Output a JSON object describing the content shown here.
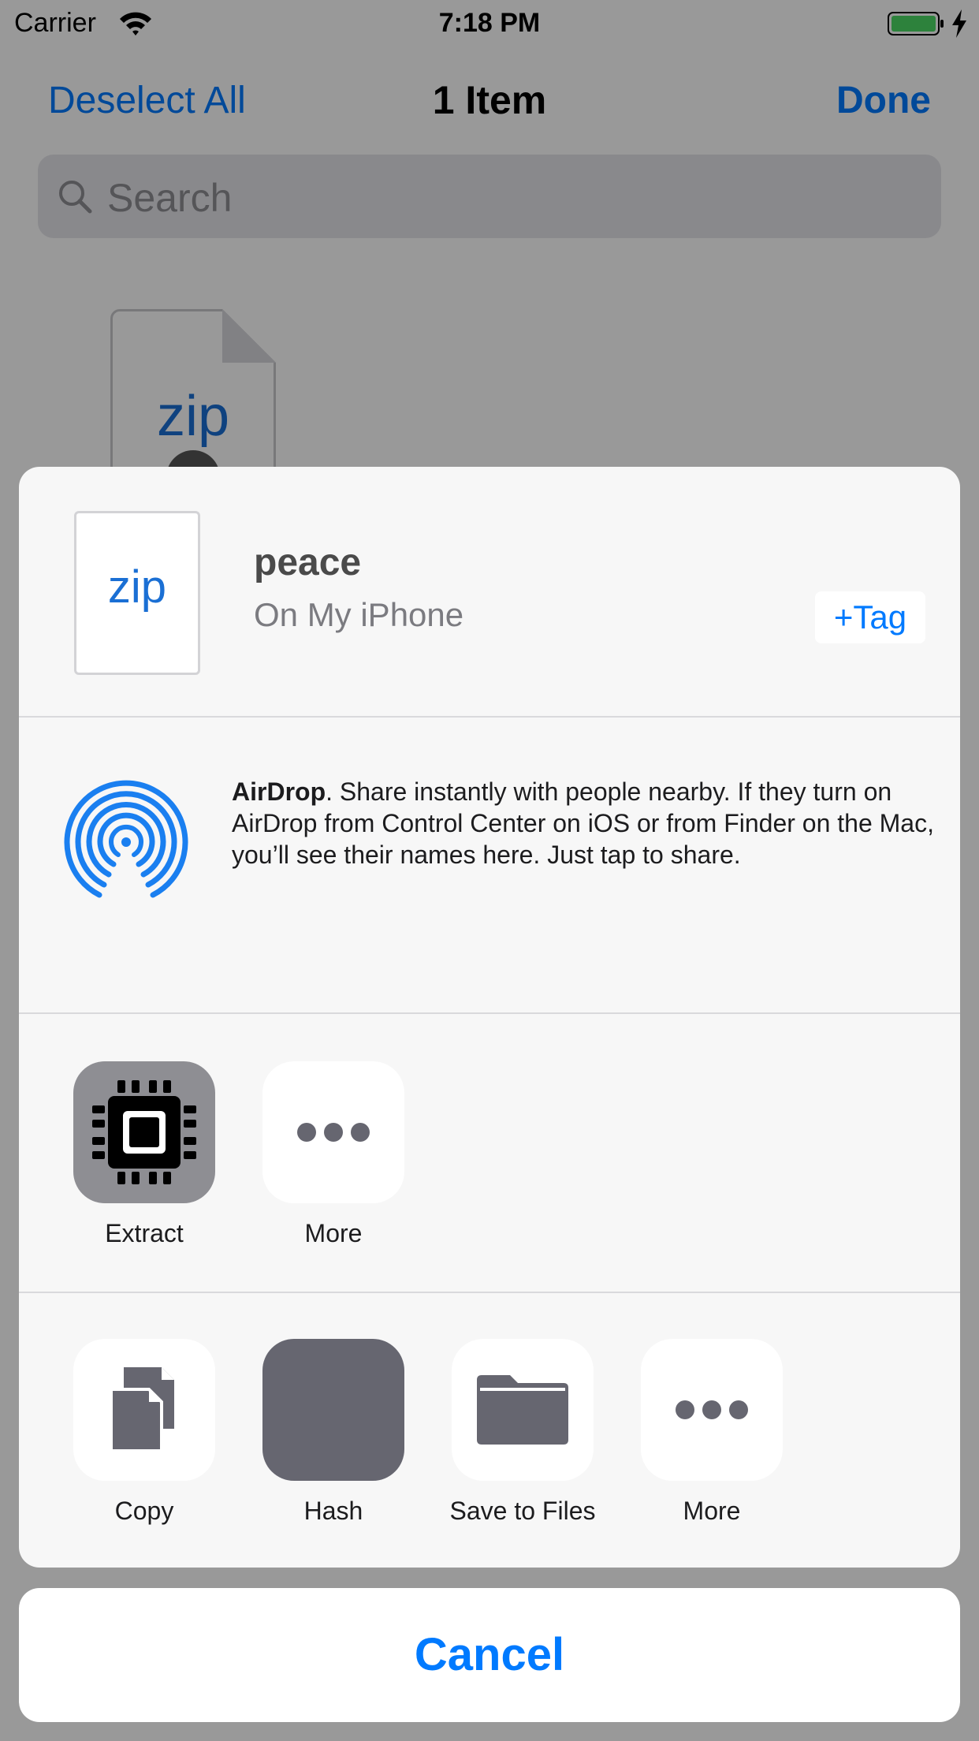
{
  "status_bar": {
    "carrier": "Carrier",
    "time": "7:18 PM"
  },
  "nav": {
    "deselect_label": "Deselect All",
    "title": "1 Item",
    "done_label": "Done"
  },
  "search": {
    "placeholder": "Search"
  },
  "background_file": {
    "type_label": "zip"
  },
  "share_sheet": {
    "file": {
      "type_label": "zip",
      "name": "peace",
      "location": "On My iPhone",
      "tag_label": "+Tag"
    },
    "airdrop": {
      "title": "AirDrop",
      "description": ". Share instantly with people nearby. If they turn on AirDrop from Control Center on iOS or from Finder on the Mac, you’ll see their names here. Just tap to share."
    },
    "app_row": [
      {
        "label": "Extract",
        "icon": "chip-icon"
      },
      {
        "label": "More",
        "icon": "more-dots-icon"
      }
    ],
    "action_row": [
      {
        "label": "Copy",
        "icon": "copy-icon"
      },
      {
        "label": "Hash",
        "icon": "hash-icon"
      },
      {
        "label": "Save to Files",
        "icon": "folder-icon"
      },
      {
        "label": "More",
        "icon": "more-dots-icon"
      }
    ]
  },
  "cancel_label": "Cancel",
  "colors": {
    "accent": "#007aff",
    "airdrop": "#1a7ff0",
    "sheet_background": "#f7f7f7",
    "icon_gray": "#666670"
  }
}
